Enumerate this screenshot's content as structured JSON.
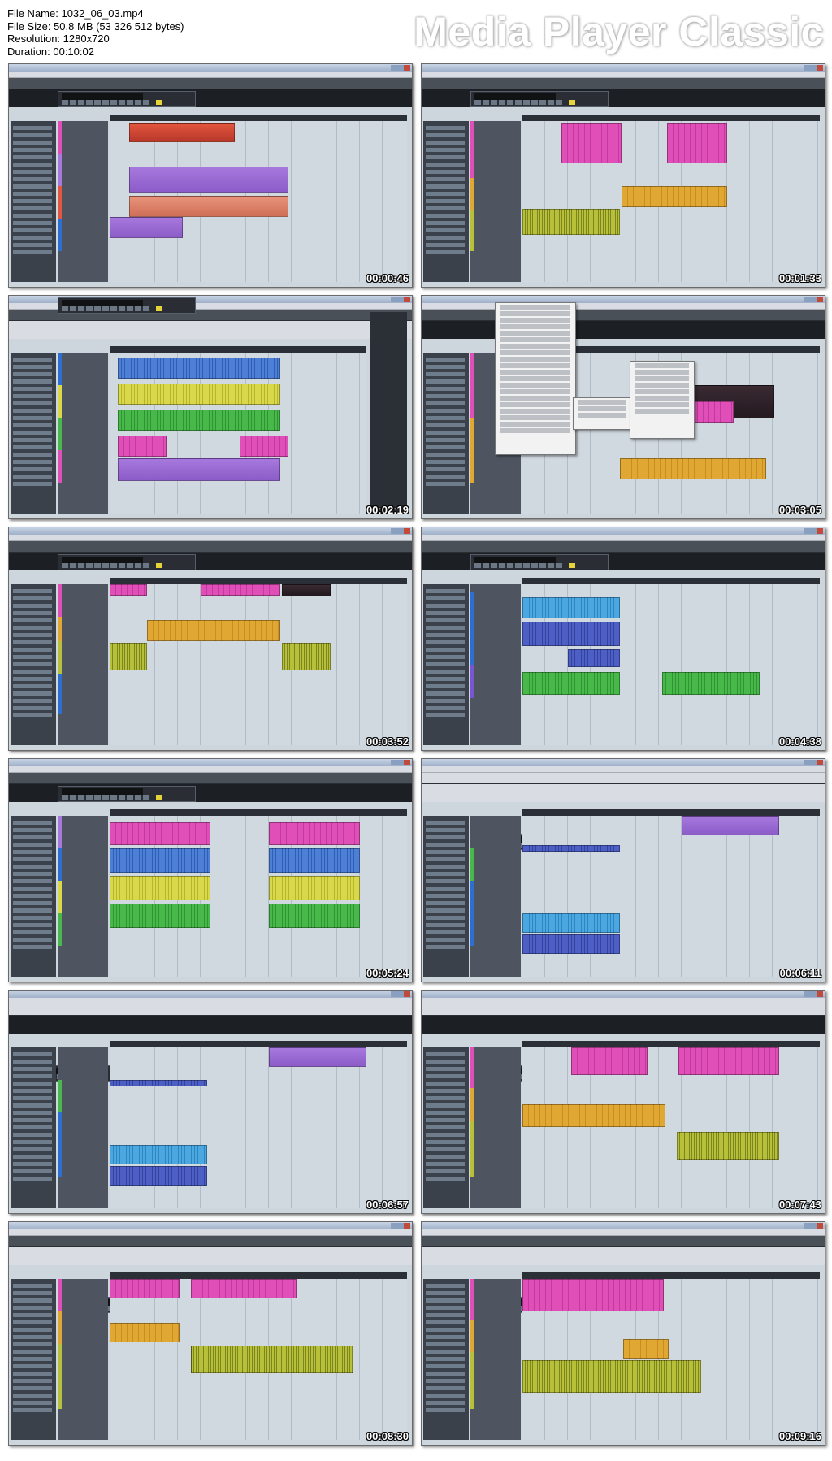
{
  "header": {
    "file_name": "File Name: 1032_06_03.mp4",
    "file_size": "File Size: 50,8 MB (53 326 512 bytes)",
    "resolution": "Resolution: 1280x720",
    "duration": "Duration: 00:10:02",
    "brand": "Media Player Classic"
  },
  "thumbnails": [
    {
      "time": "00:00:46"
    },
    {
      "time": "00:01:33"
    },
    {
      "time": "00:02:19"
    },
    {
      "time": "00:03:05"
    },
    {
      "time": "00:03:52"
    },
    {
      "time": "00:04:38"
    },
    {
      "time": "00:05:24"
    },
    {
      "time": "00:06:11"
    },
    {
      "time": "00:06:57"
    },
    {
      "time": "00:07:43"
    },
    {
      "time": "00:08:30"
    },
    {
      "time": "00:09:16"
    }
  ],
  "colors": {
    "pink": "#e04fb7",
    "orange": "#e0a833",
    "olive": "#b8c03a",
    "blue": "#4d7fd6",
    "yellow": "#d8d84a",
    "green": "#48b84a",
    "purple": "#a778dd",
    "red": "#e2573d"
  }
}
